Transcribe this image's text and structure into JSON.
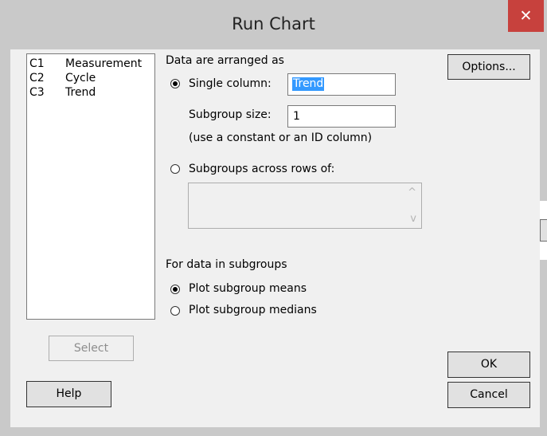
{
  "window": {
    "title": "Run Chart",
    "close_glyph": "✕"
  },
  "columns": [
    {
      "id": "C1",
      "name": "Measurement"
    },
    {
      "id": "C2",
      "name": "Cycle"
    },
    {
      "id": "C3",
      "name": "Trend"
    }
  ],
  "arrangement": {
    "heading": "Data are arranged as",
    "single_column_label": "Single column:",
    "single_column_value": "Trend",
    "subgroup_size_label": "Subgroup size:",
    "subgroup_size_value": "1",
    "hint": "(use a constant or an ID column)",
    "across_rows_label": "Subgroups across rows of:",
    "selected": "single_column"
  },
  "subgroups": {
    "heading": "For data in subgroups",
    "means_label": "Plot subgroup means",
    "medians_label": "Plot subgroup medians",
    "selected": "means"
  },
  "buttons": {
    "options": "Options...",
    "select": "Select",
    "help": "Help",
    "ok": "OK",
    "cancel": "Cancel"
  },
  "scroll_glyphs": {
    "up": "^",
    "down": "v"
  }
}
